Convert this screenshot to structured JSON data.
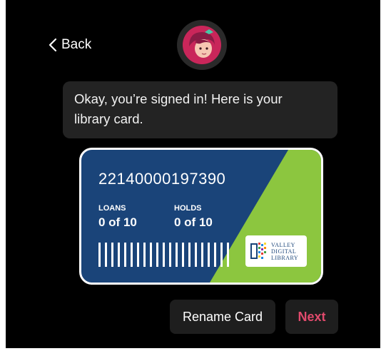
{
  "nav": {
    "back_label": "Back"
  },
  "assistant_message": {
    "line1": "Okay, you’re signed in! Here is your",
    "line2": "library card."
  },
  "card": {
    "number": "22140000197390",
    "loans_label": "LOANS",
    "loans_value": "0 of 10",
    "holds_label": "HOLDS",
    "holds_value": "0 of 10",
    "library_logo_text": [
      "VALLEY",
      "DIGITAL",
      "LIBRARY"
    ]
  },
  "buttons": {
    "rename_label": "Rename Card",
    "next_label": "Next"
  },
  "colors": {
    "background": "#000000",
    "bubble": "#232323",
    "card_blue": "#1a4479",
    "card_green": "#8cc63f",
    "accent_next": "#e04a6c"
  },
  "icons": {
    "back": "chevron-left-icon",
    "avatar": "libby-avatar-icon",
    "logo": "valley-digital-library-logo"
  }
}
